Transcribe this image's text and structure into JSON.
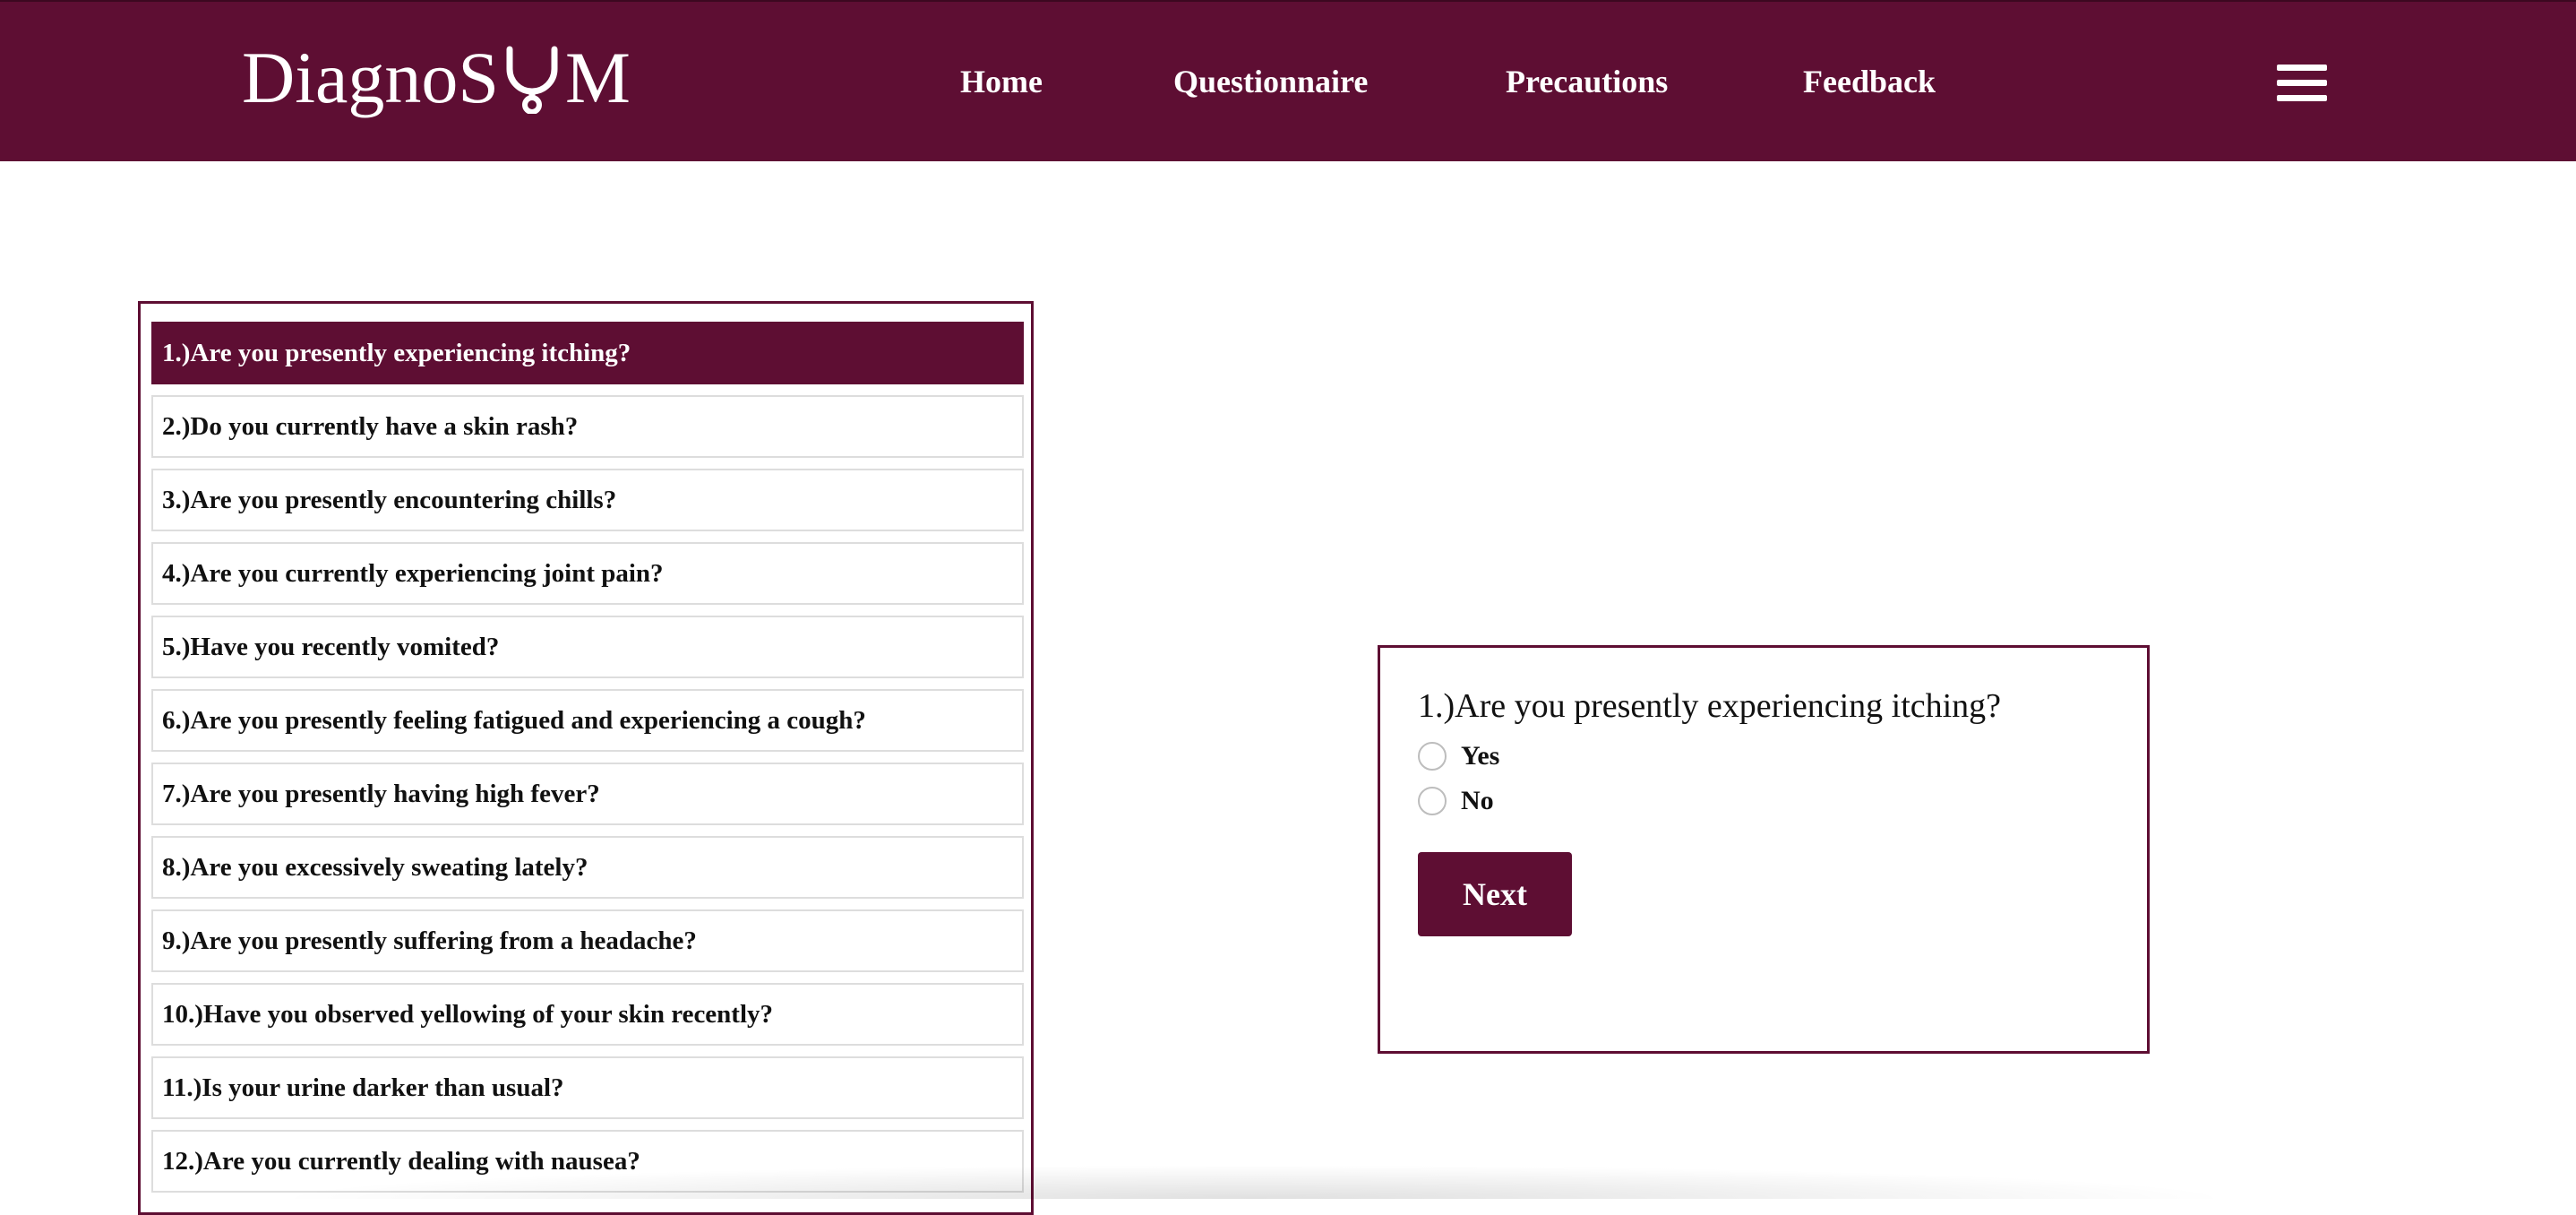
{
  "brand": {
    "logo_before": "DiagnoS",
    "logo_after": "M",
    "logo_icon": "stethoscope-icon"
  },
  "nav": {
    "links": [
      "Home",
      "Questionnaire",
      "Precautions",
      "Feedback"
    ],
    "menu_icon": "hamburger-menu-icon"
  },
  "questions": [
    "1.)Are you presently experiencing itching?",
    "2.)Do you currently have a skin rash?",
    "3.)Are you presently encountering chills?",
    "4.)Are you currently experiencing joint pain?",
    "5.)Have you recently vomited?",
    "6.)Are you presently feeling fatigued and experiencing a cough?",
    "7.)Are you presently having high fever?",
    "8.)Are you excessively sweating lately?",
    "9.)Are you presently suffering from a headache?",
    "10.)Have you observed yellowing of your skin recently?",
    "11.)Is your urine darker than usual?",
    "12.)Are you currently dealing with nausea?"
  ],
  "active_question_index": 0,
  "current_question": {
    "text": "1.)Are you presently experiencing itching?",
    "options": [
      "Yes",
      "No"
    ],
    "next_label": "Next"
  },
  "colors": {
    "primary": "#5e0e33",
    "text": "#111111",
    "background": "#ffffff"
  }
}
